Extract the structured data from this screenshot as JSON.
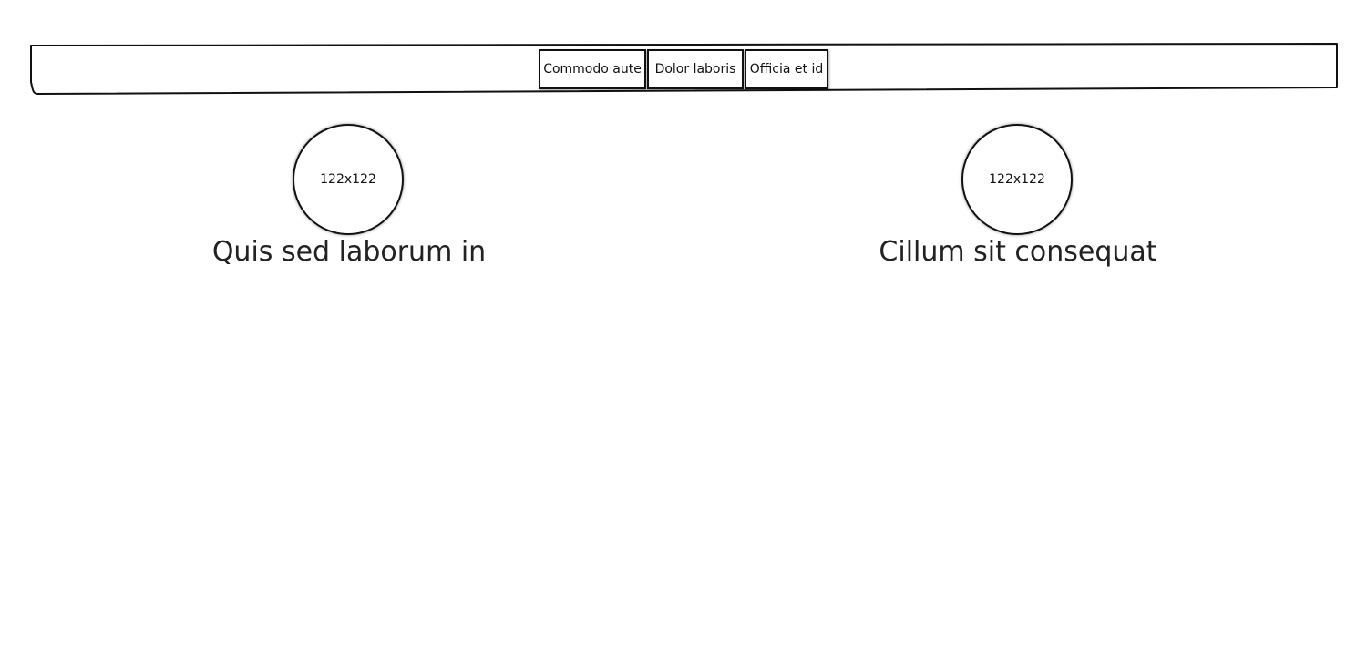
{
  "nav": {
    "tabs": [
      {
        "label": "Commodo aute"
      },
      {
        "label": "Dolor laboris"
      },
      {
        "label": "Officia et id"
      }
    ]
  },
  "cards": [
    {
      "image_label": "122x122",
      "title": "Quis sed laborum in"
    },
    {
      "image_label": "122x122",
      "title": "Cillum sit consequat"
    }
  ],
  "colors": {
    "stroke": "#111111",
    "text": "#222222",
    "background": "#ffffff"
  }
}
